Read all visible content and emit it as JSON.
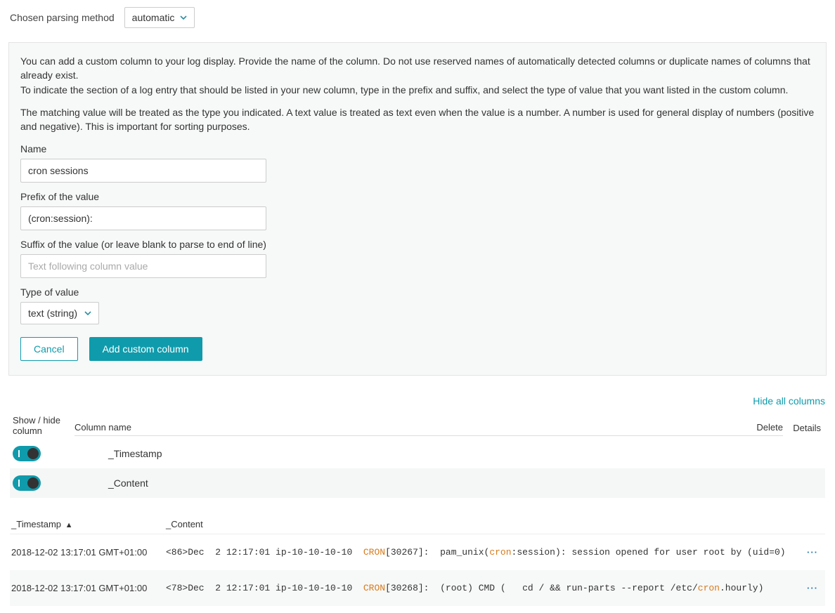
{
  "top": {
    "label": "Chosen parsing method",
    "value": "automatic"
  },
  "help": {
    "p1": "You can add a custom column to your log display. Provide the name of the column. Do not use reserved names of automatically detected columns or duplicate names of columns that already exist.",
    "p2": "To indicate the section of a log entry that should be listed in your new column, type in the prefix and suffix, and select the type of value that you want listed in the custom column.",
    "p3": "The matching value will be treated as the type you indicated. A text value is treated as text even when the value is a number. A number is used for general display of numbers (positive and negative). This is important for sorting purposes."
  },
  "form": {
    "name_label": "Name",
    "name_value": "cron sessions",
    "prefix_label": "Prefix of the value",
    "prefix_value": "(cron:session):",
    "suffix_label": "Suffix of the value (or leave blank to parse to end of line)",
    "suffix_placeholder": "Text following column value",
    "suffix_value": "",
    "type_label": "Type of value",
    "type_value": "text (string)",
    "cancel": "Cancel",
    "add": "Add custom column"
  },
  "columns_section": {
    "hide_all": "Hide all columns",
    "header_showhide_l1": "Show / hide",
    "header_showhide_l2": "column",
    "header_name": "Column name",
    "header_delete": "Delete",
    "header_details": "Details",
    "rows": [
      {
        "name": "_Timestamp",
        "on": true
      },
      {
        "name": "_Content",
        "on": true
      }
    ]
  },
  "log_table": {
    "header_ts": "_Timestamp",
    "header_content": "_Content",
    "sort_indicator": "▲",
    "rows": [
      {
        "ts": "2018-12-02 13:17:01 GMT+01:00",
        "segments": [
          {
            "t": "<86>Dec  2 12:17:01 ip-10-10-10-10  ",
            "hl": false
          },
          {
            "t": "CRON",
            "hl": true
          },
          {
            "t": "[30267]:  pam_unix(",
            "hl": false
          },
          {
            "t": "cron",
            "hl": true
          },
          {
            "t": ":session): session opened for user root by (uid=0)",
            "hl": false
          }
        ]
      },
      {
        "ts": "2018-12-02 13:17:01 GMT+01:00",
        "segments": [
          {
            "t": "<78>Dec  2 12:17:01 ip-10-10-10-10  ",
            "hl": false
          },
          {
            "t": "CRON",
            "hl": true
          },
          {
            "t": "[30268]:  (root) CMD (   cd / && run-parts --report /etc/",
            "hl": false
          },
          {
            "t": "cron",
            "hl": true
          },
          {
            "t": ".hourly)",
            "hl": false
          }
        ]
      }
    ]
  }
}
